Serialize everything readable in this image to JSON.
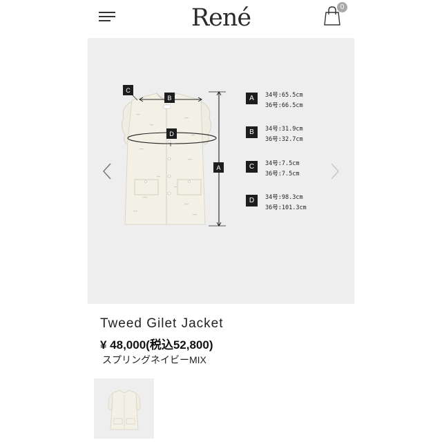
{
  "header": {
    "logo": "René",
    "cart_count": "0"
  },
  "size_chart": {
    "diagram_labels": [
      "A",
      "B",
      "C",
      "D"
    ],
    "measurements": [
      {
        "key": "A",
        "line1": "34号:65.5cm",
        "line2": "36号:66.5cm"
      },
      {
        "key": "B",
        "line1": "34号:31.9cm",
        "line2": "36号:32.7cm"
      },
      {
        "key": "C",
        "line1": "34号:7.5cm",
        "line2": "36号:7.5cm"
      },
      {
        "key": "D",
        "line1": "34号:98.3cm",
        "line2": "36号:101.3cm"
      }
    ]
  },
  "product": {
    "name": "Tweed Gilet Jacket",
    "price": "¥ 48,000(税込52,800)",
    "color": "スプリングネイビーMIX"
  },
  "colors": {
    "background": "#ffffff",
    "gallery_bg": "#eeeeee",
    "label_box": "#1d1d1d",
    "badge": "#a9a9a9",
    "garment": "#f3f1e6"
  },
  "icons": {
    "menu": "hamburger-icon",
    "cart": "shopping-bag-icon",
    "prev": "chevron-left-icon",
    "next": "chevron-right-icon"
  }
}
